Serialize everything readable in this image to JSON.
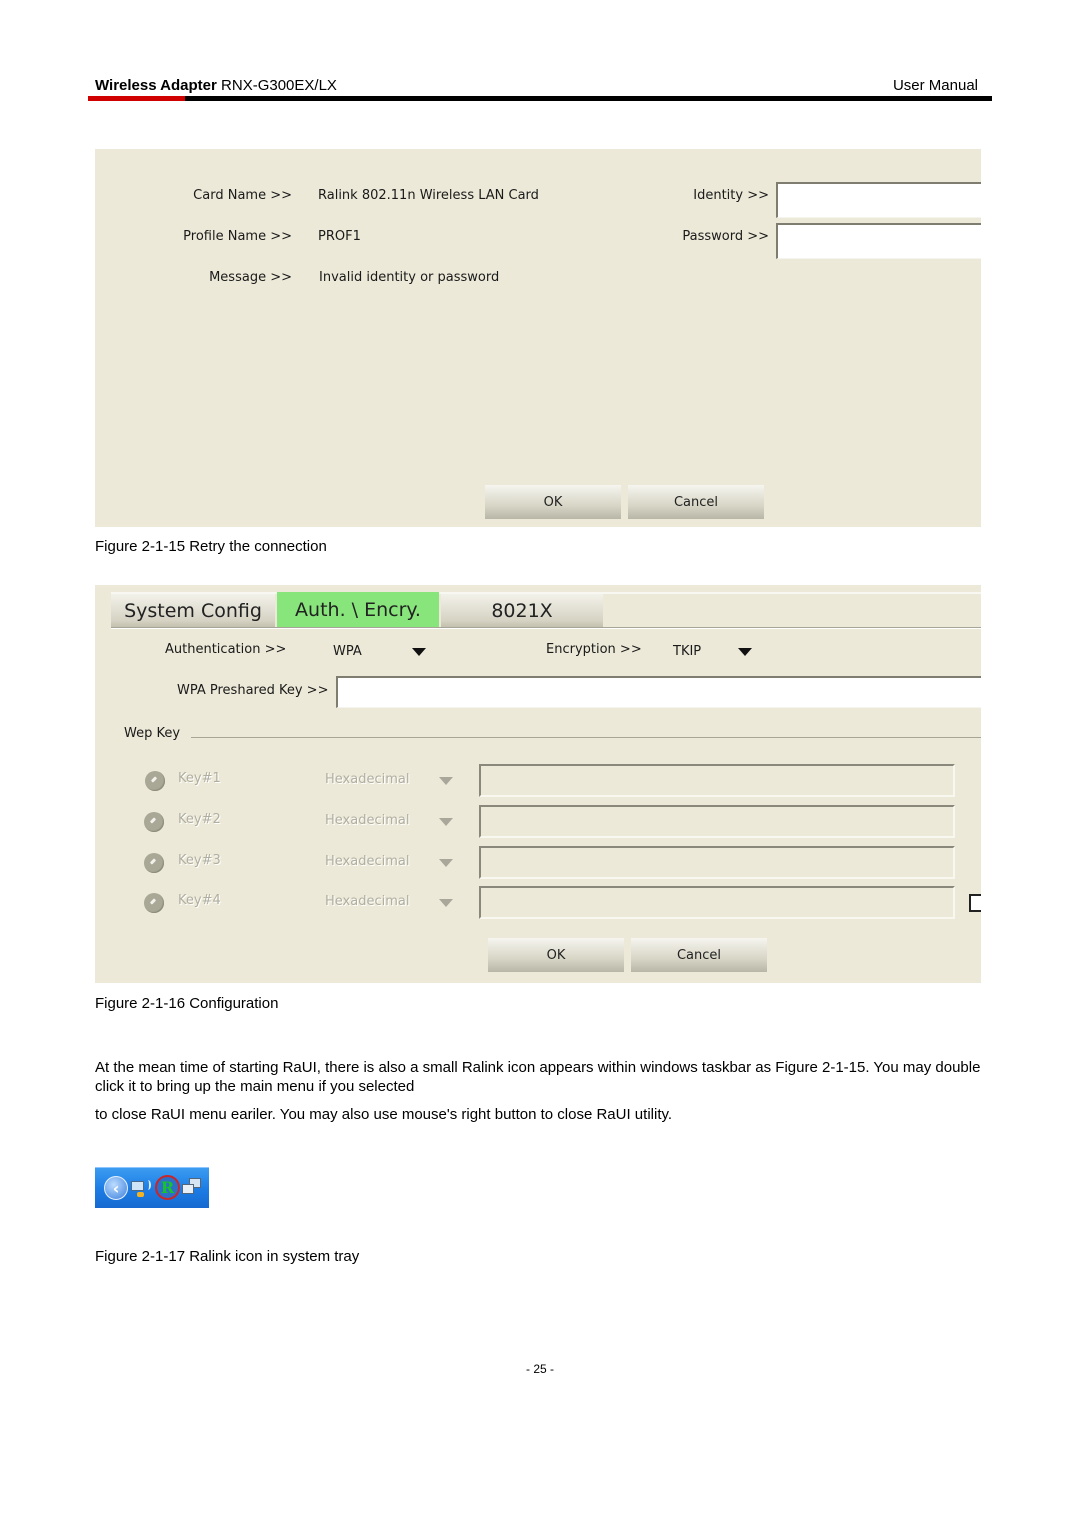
{
  "header": {
    "product_bold": "Wireless Adapter",
    "product_model": " RNX-G300EX/LX",
    "doc_type": "User Manual",
    "colors": {
      "accent_red": "#d00000",
      "rule_black": "#000000"
    }
  },
  "figure_15": {
    "card_name_label": "Card Name >>",
    "card_name_value": "Ralink 802.11n Wireless LAN Card",
    "profile_name_label": "Profile Name >>",
    "profile_name_value": "PROF1",
    "message_label": "Message >>",
    "message_value": "Invalid identity or password",
    "identity_label": "Identity >>",
    "identity_value": "",
    "password_label": "Password >>",
    "password_value": "",
    "ok_label": "OK",
    "cancel_label": "Cancel",
    "caption": "Figure 2-1-15 Retry the connection"
  },
  "figure_16": {
    "tabs": [
      {
        "label": "System Config",
        "active": false
      },
      {
        "label": "Auth. \\ Encry.",
        "active": true
      },
      {
        "label": "8021X",
        "active": false
      }
    ],
    "active_tab_color": "#88e57c",
    "authentication_label": "Authentication >>",
    "authentication_value": "WPA",
    "encryption_label": "Encryption >>",
    "encryption_value": "TKIP",
    "psk_label": "WPA Preshared Key >>",
    "psk_value": "",
    "wep_key_group_label": "Wep Key",
    "wep_keys": [
      {
        "label": "Key#1",
        "format": "Hexadecimal",
        "value": ""
      },
      {
        "label": "Key#2",
        "format": "Hexadecimal",
        "value": ""
      },
      {
        "label": "Key#3",
        "format": "Hexadecimal",
        "value": ""
      },
      {
        "label": "Key#4",
        "format": "Hexadecimal",
        "value": ""
      }
    ],
    "ok_label": "OK",
    "cancel_label": "Cancel",
    "caption": "Figure 2-1-16 Configuration"
  },
  "body": {
    "paragraph_1": "At the mean time of starting RaUI, there is also a small Ralink icon appears within windows taskbar as Figure 2-1-15. You may double click it to bring up the main menu if you selected",
    "paragraph_2": "to close RaUI menu eariler. You may also use mouse's right button to close RaUI utility."
  },
  "figure_17": {
    "tray_icons": [
      "back-chevron-icon",
      "wireless-network-icon",
      "ralink-icon",
      "network-computers-icon"
    ],
    "caption": "Figure 2-1-17 Ralink icon in system tray"
  },
  "footer": {
    "page_number": "- 25 -"
  }
}
